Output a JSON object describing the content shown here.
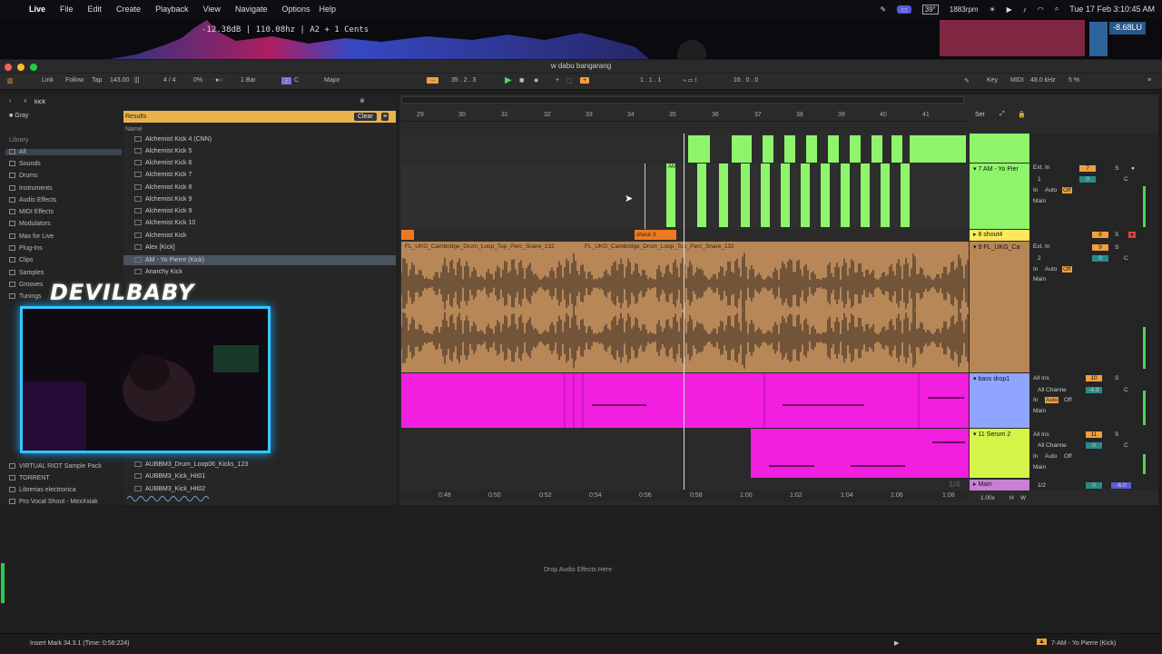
{
  "menubar": {
    "app": "Live",
    "items": [
      "File",
      "Edit",
      "Create",
      "Playback",
      "View",
      "Navigate",
      "Options",
      "Help"
    ],
    "temp": "39°",
    "rpm": "1883rpm",
    "clock": "Tue 17 Feb 3:10:45 AM"
  },
  "viz": {
    "readout": "-12.38dB | 110.08hz | A2 + 1 Cents",
    "lu": "-8.68LU"
  },
  "window": {
    "title": "w dabu bangarang"
  },
  "transport": {
    "link": "Link",
    "follow": "Follow",
    "tap": "Tap",
    "tempo": "143.00",
    "sig": "4 / 4",
    "pct": "0%",
    "quant": "1 Bar",
    "key": "C",
    "scale": "Major",
    "position": "35 .  2 .  3",
    "loop_start": "1 .  1 .  1",
    "loop_len": "16 .  0 .  0",
    "key_label": "Key",
    "midi_label": "MIDI",
    "sample_rate": "48.0 kHz",
    "cpu": "5 %"
  },
  "browser": {
    "search": "kick",
    "color": "Gray",
    "library_label": "Library",
    "places": [
      "All",
      "Sounds",
      "Drums",
      "Instruments",
      "Audio Effects",
      "MIDI Effects",
      "Modulators",
      "Max for Live",
      "Plug-Ins",
      "Clips",
      "Samples",
      "Grooves",
      "Tunings"
    ],
    "places_lower": [
      "VIRTUAL RIOT Sample Pack",
      "TORRENT",
      "Librerias electronica",
      "Pro Vocal Shout - MexXxiak"
    ],
    "results_label": "Results",
    "clear": "Clear",
    "name_col": "Name",
    "results": [
      "Alchemist Kick 4 (CNN)",
      "Alchemist Kick 5",
      "Alchemist Kick 6",
      "Alchemist Kick 7",
      "Alchemist Kick 8",
      "Alchemist Kick 9",
      "Alchemist Kick 9",
      "Alchemist Kick 10",
      "Alchemist Kick",
      "Alex [Kick]",
      "AM - Yo Pierre (Kick)",
      "Anarchy Kick"
    ],
    "results_lower": [
      "AUBBM3_Drum_Loop06_Kicks_123",
      "AUBBM3_Kick_Hit01",
      "AUBBM3_Kick_Hit02"
    ]
  },
  "overlay": {
    "streamer": "DEVILBABY"
  },
  "arrangement": {
    "bars": [
      "29",
      "30",
      "31",
      "32",
      "33",
      "34",
      "35",
      "36",
      "37",
      "38",
      "39",
      "40",
      "41"
    ],
    "times": [
      "0:48",
      "0:50",
      "0:52",
      "0:54",
      "0:56",
      "0:58",
      "1:00",
      "1:02",
      "1:04",
      "1:06",
      "1:08"
    ],
    "set": "Set",
    "clip_shout": "shout 3",
    "clip_audio": "FL_UKG_Cambridge_Drum_Loop_Top_Perc_Snare_132",
    "zoom": "1/4",
    "ghost_label": "AM"
  },
  "tracks": [
    {
      "name": "7 AM - Yo Pier",
      "input": "Ext. In",
      "channel": "1",
      "out": "Main",
      "num": "7",
      "vol": "0",
      "pan": "C",
      "color": "#8ef56b"
    },
    {
      "name": "8 shout4",
      "num": "8",
      "color": "#ffe95a"
    },
    {
      "name": "9 FL_UKG_Ca",
      "input": "Ext. In",
      "channel": "2",
      "out": "Main",
      "num": "9",
      "vol": "0",
      "pan": "C",
      "color": "#b88758"
    },
    {
      "name": "bass drop1",
      "input": "All Ins",
      "channel": "All Channe",
      "out": "Main",
      "num": "10",
      "vol": "-4.9",
      "pan": "C",
      "color": "#8fa5ff"
    },
    {
      "name": "11 Serum 2",
      "input": "All Ins",
      "channel": "All Channe",
      "out": "Main",
      "num": "11",
      "vol": "0",
      "pan": "C",
      "color": "#d3f54a"
    },
    {
      "name": "Main",
      "num": "1/2",
      "vol": "0",
      "pan": "-6.0",
      "color": "#c780d4"
    }
  ],
  "monitor": {
    "in": "In",
    "auto": "Auto",
    "off": "Off"
  },
  "tempo_factor": "1.00x",
  "hw": [
    "H",
    "W"
  ],
  "drop_hint": "Drop Audio Effects Here",
  "status": {
    "left": "Insert Mark 34.3.1 (Time: 0:56:224)",
    "right": "7-AM - Yo Pierre (Kick)"
  },
  "colors": {
    "accent": "#f0a040",
    "green": "#8ef56b",
    "brown": "#b88758",
    "magenta": "#f21ee0",
    "cyan": "#35c6ff"
  }
}
